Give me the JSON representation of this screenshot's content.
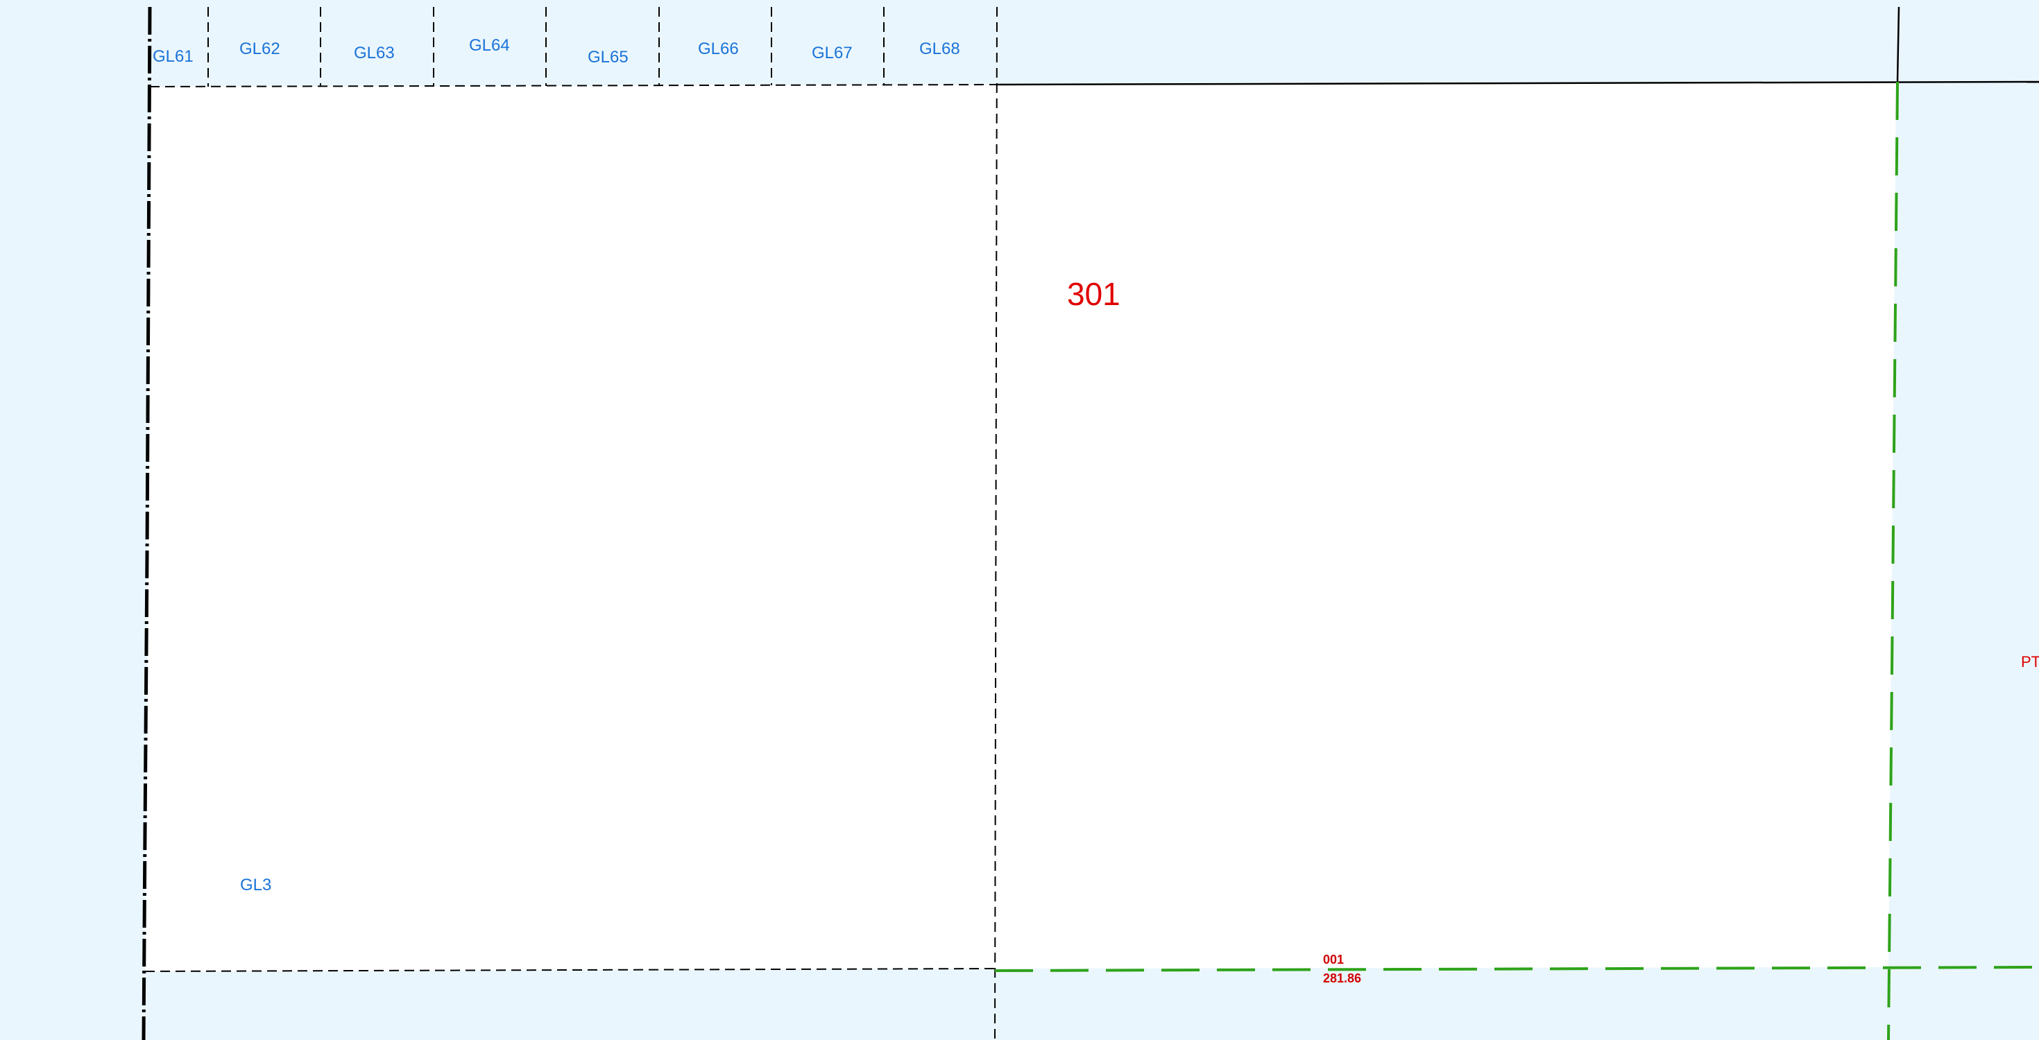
{
  "map": {
    "colors": {
      "water_fill": "#eaf6fd",
      "parcel_fill": "#ffffff",
      "lot_label": "#1a73d8",
      "parcel_label": "#e00000",
      "boundary_line": "#000000",
      "highlight_boundary": "#2ea31a"
    },
    "lots": [
      {
        "label": "GL61"
      },
      {
        "label": "GL62"
      },
      {
        "label": "GL63"
      },
      {
        "label": "GL64"
      },
      {
        "label": "GL65"
      },
      {
        "label": "GL66"
      },
      {
        "label": "GL67"
      },
      {
        "label": "GL68"
      }
    ],
    "lot_gl3": "GL3",
    "parcel_number": "301",
    "segment": {
      "id": "001",
      "length": "281.86"
    },
    "edge_label": "PT"
  }
}
